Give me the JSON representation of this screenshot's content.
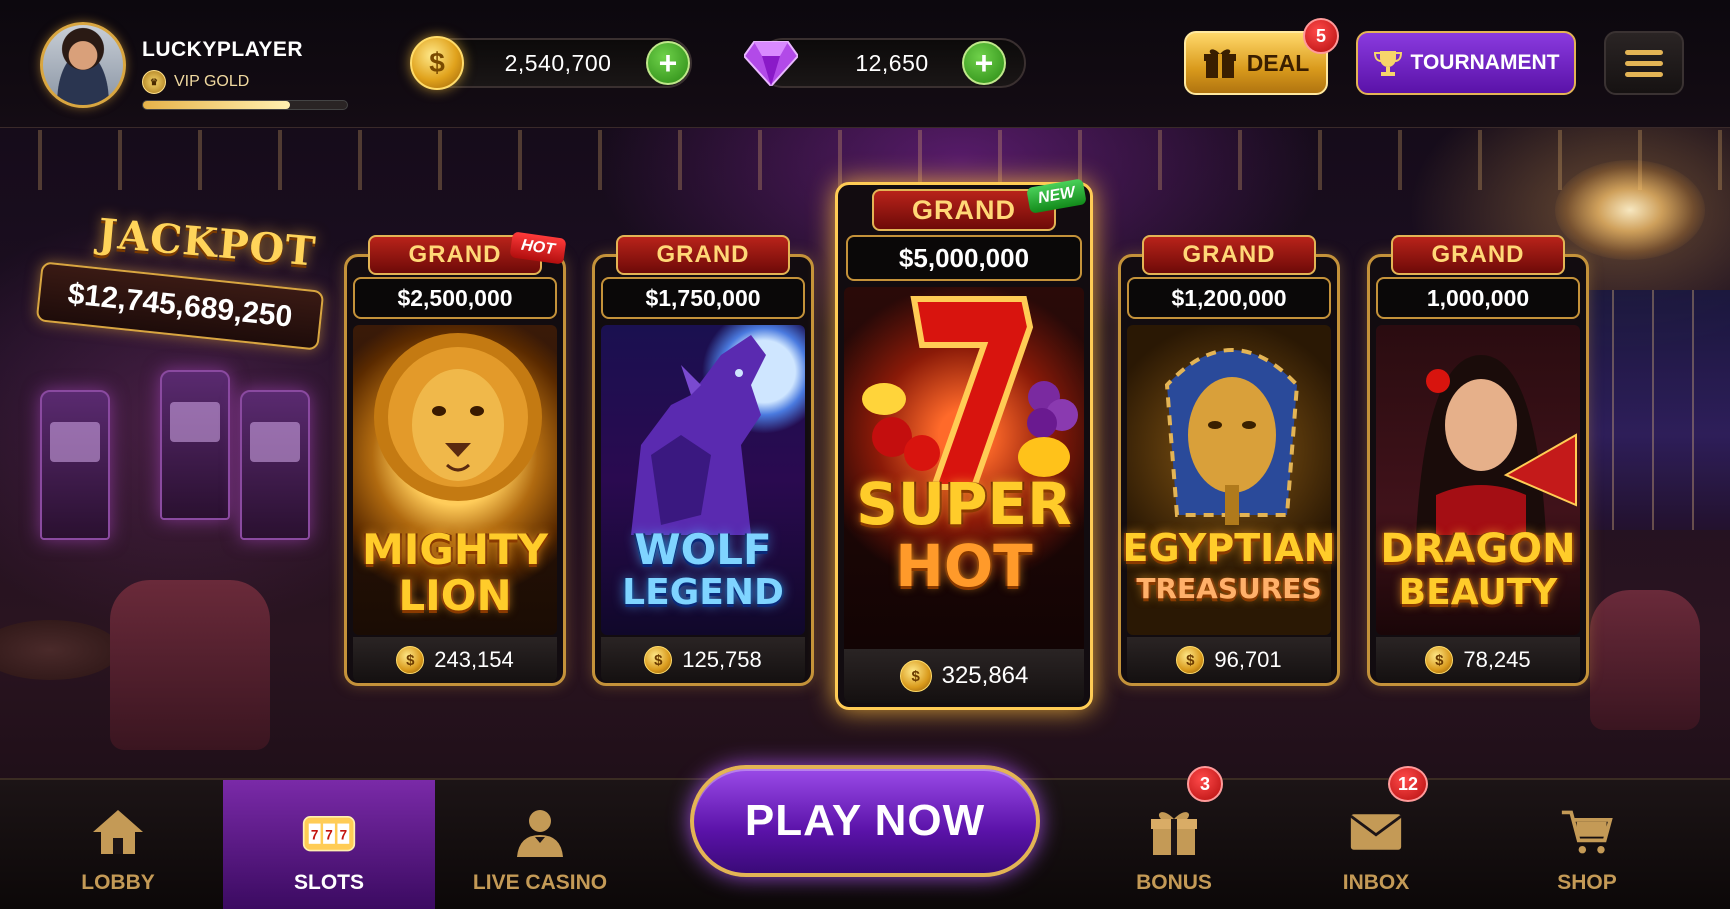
{
  "player": {
    "name": "LUCKYPLAYER",
    "vip_level": "VIP GOLD",
    "vip_progress": 0.72
  },
  "currencies": {
    "coins": "2,540,700",
    "gems": "12,650"
  },
  "header_buttons": {
    "deal_label": "DEAL",
    "deal_badge": "5",
    "tournament_label": "TOURNAMENT"
  },
  "jackpot": {
    "title": "JACKPOT",
    "amount": "$12,745,689,250"
  },
  "games": [
    {
      "tier": "GRAND",
      "prize": "$2,500,000",
      "title_line1": "MIGHTY",
      "title_line2": "LION",
      "players": "243,154",
      "tag": "HOT"
    },
    {
      "tier": "GRAND",
      "prize": "$1,750,000",
      "title_line1": "WOLF",
      "title_line2": "LEGEND",
      "players": "125,758"
    },
    {
      "tier": "GRAND",
      "prize": "$5,000,000",
      "title_line1": "SUPER",
      "title_line2": "HOT",
      "players": "325,864",
      "tag": "NEW"
    },
    {
      "tier": "GRAND",
      "prize": "$1,200,000",
      "title_line1": "EGYPTIAN",
      "title_line2": "TREASURES",
      "players": "96,701"
    },
    {
      "tier": "GRAND",
      "prize": "1,000,000",
      "title_line1": "DRAGON",
      "title_line2": "BEAUTY",
      "players": "78,245"
    }
  ],
  "play_now_label": "PLAY NOW",
  "nav": [
    {
      "label": "LOBBY",
      "icon": "home-icon"
    },
    {
      "label": "SLOTS",
      "icon": "slot-machine-icon",
      "active": true
    },
    {
      "label": "LIVE CASINO",
      "icon": "dealer-icon"
    },
    {
      "label": "BONUS",
      "icon": "gift-icon",
      "badge": "3"
    },
    {
      "label": "INBOX",
      "icon": "mail-icon",
      "badge": "12"
    },
    {
      "label": "SHOP",
      "icon": "cart-icon"
    }
  ],
  "coin_symbol": "$"
}
